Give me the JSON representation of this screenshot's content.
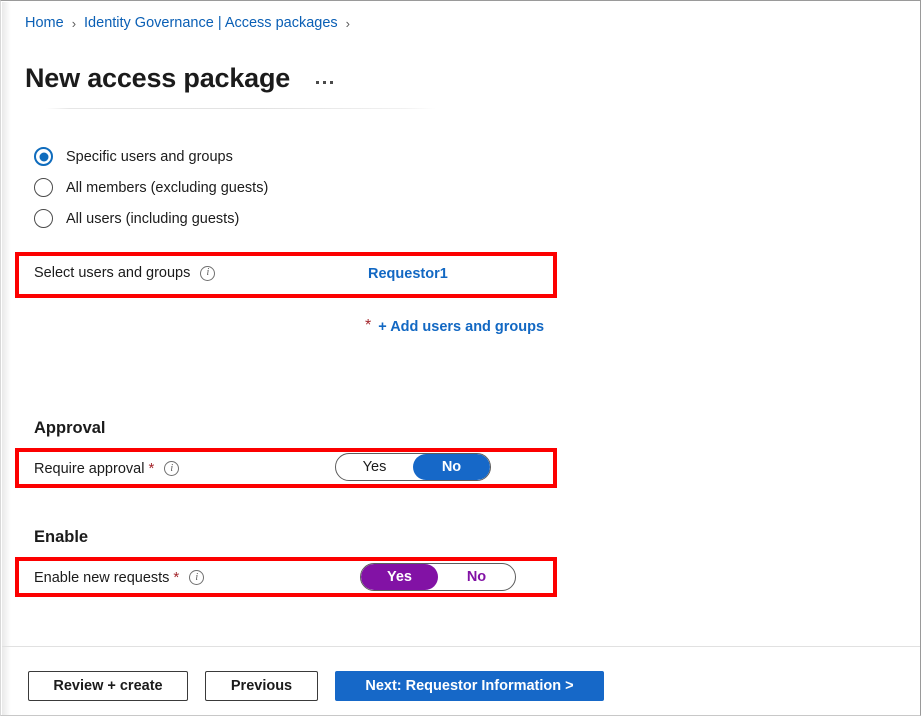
{
  "breadcrumb": {
    "items": [
      {
        "label": "Home"
      },
      {
        "label": "Identity Governance | Access packages"
      }
    ],
    "separator": "›"
  },
  "header": {
    "title": "New access package",
    "more_menu_label": "…"
  },
  "scope": {
    "options": [
      {
        "label": "Specific users and groups",
        "selected": true
      },
      {
        "label": "All members (excluding guests)",
        "selected": false
      },
      {
        "label": "All users (including guests)",
        "selected": false
      }
    ]
  },
  "select_users": {
    "label": "Select users and groups",
    "info_icon": "info-icon",
    "value_link": "Requestor1",
    "required_marker": "*",
    "add_link": "+ Add users and groups"
  },
  "approval": {
    "heading": "Approval",
    "field_label": "Require approval",
    "required_marker": "*",
    "info_icon": "info-icon",
    "toggle": {
      "yes_label": "Yes",
      "no_label": "No",
      "selected": "No",
      "accent_color": "#1668c8"
    }
  },
  "enable": {
    "heading": "Enable",
    "field_label": "Enable new requests",
    "required_marker": "*",
    "info_icon": "info-icon",
    "toggle": {
      "yes_label": "Yes",
      "no_label": "No",
      "selected": "Yes",
      "accent_color": "#8212a5"
    }
  },
  "footer": {
    "review_create_label": "Review + create",
    "previous_label": "Previous",
    "next_label": "Next: Requestor Information >"
  },
  "annotations": {
    "highlight_color": "#fc0000",
    "boxes": [
      "select-users-row",
      "require-approval-row",
      "enable-new-requests-row"
    ]
  }
}
